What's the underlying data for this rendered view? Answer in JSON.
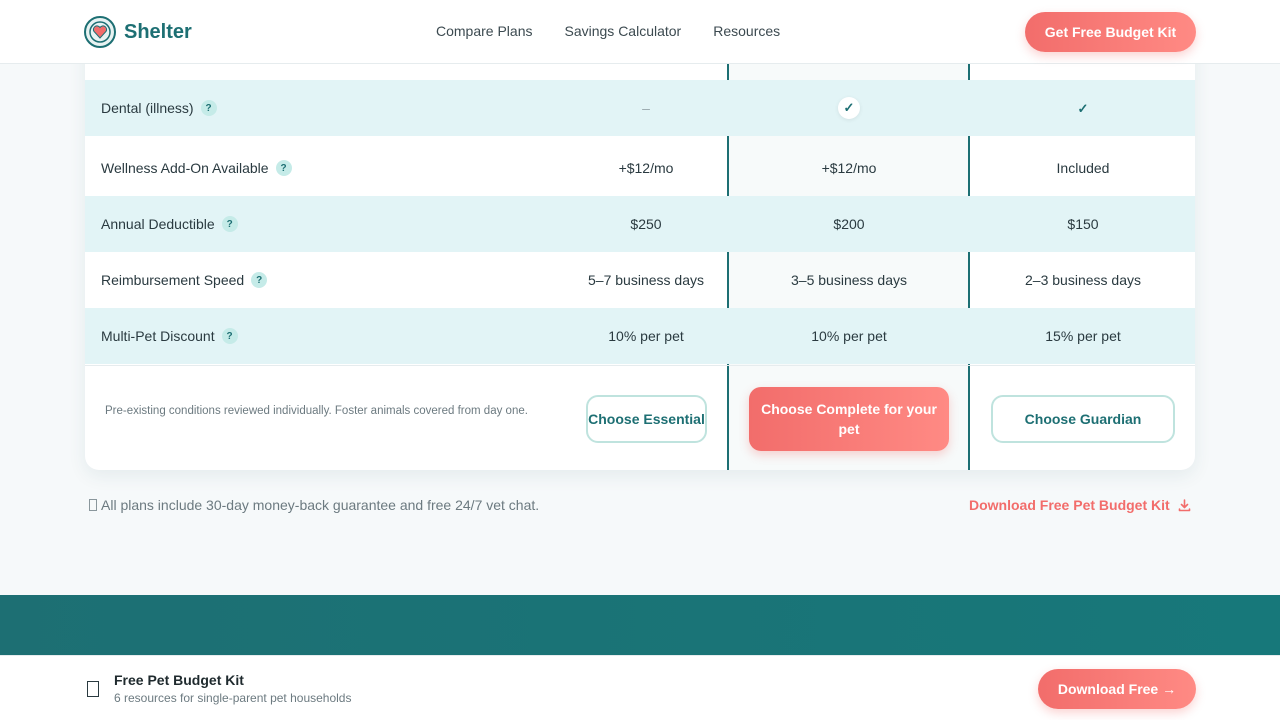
{
  "header": {
    "brand": "Shelter",
    "nav": [
      "Compare Plans",
      "Savings Calculator",
      "Resources"
    ],
    "cta": "Get Free Budget Kit"
  },
  "table": {
    "rows": [
      {
        "label": "Dental (illness)",
        "essential": "–",
        "complete": "✓",
        "guardian": "✓"
      },
      {
        "label": "Wellness Add-On Available",
        "essential": "+$12/mo",
        "complete": "+$12/mo",
        "guardian": "Included"
      },
      {
        "label": "Annual Deductible",
        "essential": "$250",
        "complete": "$200",
        "guardian": "$150"
      },
      {
        "label": "Reimbursement Speed",
        "essential": "5–7 business days",
        "complete": "3–5 business days",
        "guardian": "2–3 business days"
      },
      {
        "label": "Multi-Pet Discount",
        "essential": "10% per pet",
        "complete": "10% per pet",
        "guardian": "15% per pet"
      }
    ],
    "help_glyph": "?",
    "footnote": "Pre-existing conditions reviewed individually. Foster animals covered from day one.",
    "buttons": {
      "essential": "Choose Essential",
      "complete": "Choose Complete for your pet",
      "guardian": "Choose Guardian"
    }
  },
  "guarantee": "All plans include 30-day money-back guarantee and free 24/7 vet chat.",
  "download_link": "Download Free Pet Budget Kit",
  "bottom_bar": {
    "title": "Free Pet Budget Kit",
    "subtitle": "6 resources for single-parent pet households",
    "cta": "Download Free →"
  },
  "colors": {
    "brand_teal": "#1d6f73",
    "accent_coral": "#f26d6b",
    "row_alt": "#e2f4f6"
  }
}
